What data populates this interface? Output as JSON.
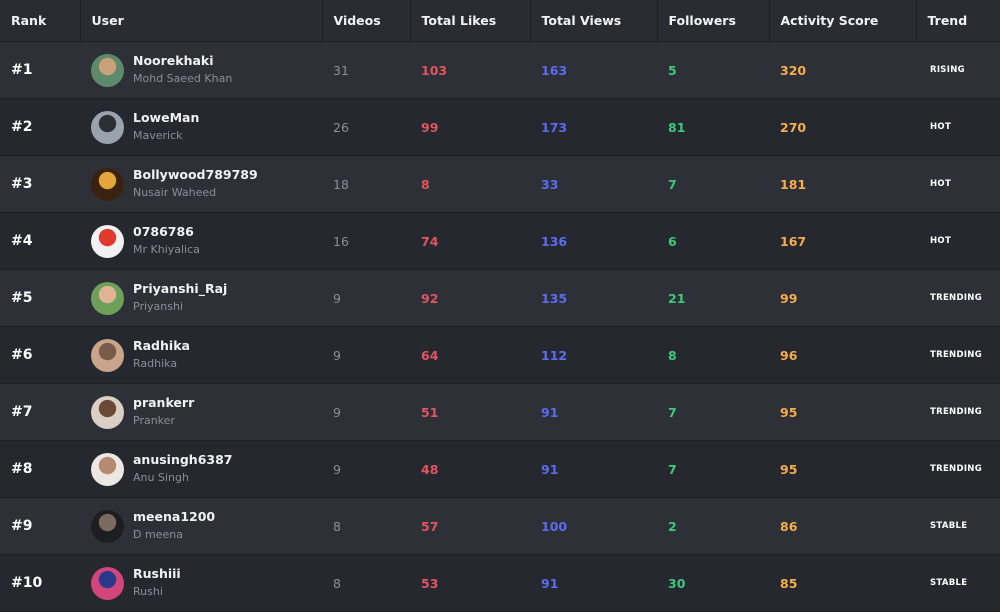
{
  "headers": {
    "rank": "Rank",
    "user": "User",
    "videos": "Videos",
    "likes": "Total Likes",
    "views": "Total Views",
    "followers": "Followers",
    "score": "Activity Score",
    "trend": "Trend"
  },
  "rows": [
    {
      "rank": "#1",
      "username": "Noorekhaki",
      "display": "Mohd Saeed Khan",
      "videos": "31",
      "likes": "103",
      "views": "163",
      "followers": "5",
      "score": "320",
      "trend": "RISING",
      "avatar_colors": [
        "#5d8a6a",
        "#c9a27a"
      ]
    },
    {
      "rank": "#2",
      "username": "LoweMan",
      "display": "Maverick",
      "videos": "26",
      "likes": "99",
      "views": "173",
      "followers": "81",
      "score": "270",
      "trend": "HOT",
      "avatar_colors": [
        "#9aa3ad",
        "#2b2f36"
      ]
    },
    {
      "rank": "#3",
      "username": "Bollywood789789",
      "display": "Nusair Waheed",
      "videos": "18",
      "likes": "8",
      "views": "33",
      "followers": "7",
      "score": "181",
      "trend": "HOT",
      "avatar_colors": [
        "#3a2210",
        "#e2a63a"
      ]
    },
    {
      "rank": "#4",
      "username": "0786786",
      "display": "Mr Khiyalica",
      "videos": "16",
      "likes": "74",
      "views": "136",
      "followers": "6",
      "score": "167",
      "trend": "HOT",
      "avatar_colors": [
        "#f1f1f1",
        "#e03a2f"
      ]
    },
    {
      "rank": "#5",
      "username": "Priyanshi_Raj",
      "display": "Priyanshi",
      "videos": "9",
      "likes": "92",
      "views": "135",
      "followers": "21",
      "score": "99",
      "trend": "TRENDING",
      "avatar_colors": [
        "#6fa05a",
        "#e0b495"
      ]
    },
    {
      "rank": "#6",
      "username": "Radhika",
      "display": "Radhika",
      "videos": "9",
      "likes": "64",
      "views": "112",
      "followers": "8",
      "score": "96",
      "trend": "TRENDING",
      "avatar_colors": [
        "#c9a48b",
        "#7a5a48"
      ]
    },
    {
      "rank": "#7",
      "username": "prankerr",
      "display": "Pranker",
      "videos": "9",
      "likes": "51",
      "views": "91",
      "followers": "7",
      "score": "95",
      "trend": "TRENDING",
      "avatar_colors": [
        "#d9cfc4",
        "#6a4a35"
      ]
    },
    {
      "rank": "#8",
      "username": "anusingh6387",
      "display": "Anu Singh",
      "videos": "9",
      "likes": "48",
      "views": "91",
      "followers": "7",
      "score": "95",
      "trend": "TRENDING",
      "avatar_colors": [
        "#ece7e2",
        "#b58a70"
      ]
    },
    {
      "rank": "#9",
      "username": "meena1200",
      "display": "D meena",
      "videos": "8",
      "likes": "57",
      "views": "100",
      "followers": "2",
      "score": "86",
      "trend": "STABLE",
      "avatar_colors": [
        "#1e1e22",
        "#7a6a60"
      ]
    },
    {
      "rank": "#10",
      "username": "Rushiii",
      "display": "Rushi",
      "videos": "8",
      "likes": "53",
      "views": "91",
      "followers": "30",
      "score": "85",
      "trend": "STABLE",
      "avatar_colors": [
        "#d2457a",
        "#2a3a8a"
      ]
    }
  ]
}
